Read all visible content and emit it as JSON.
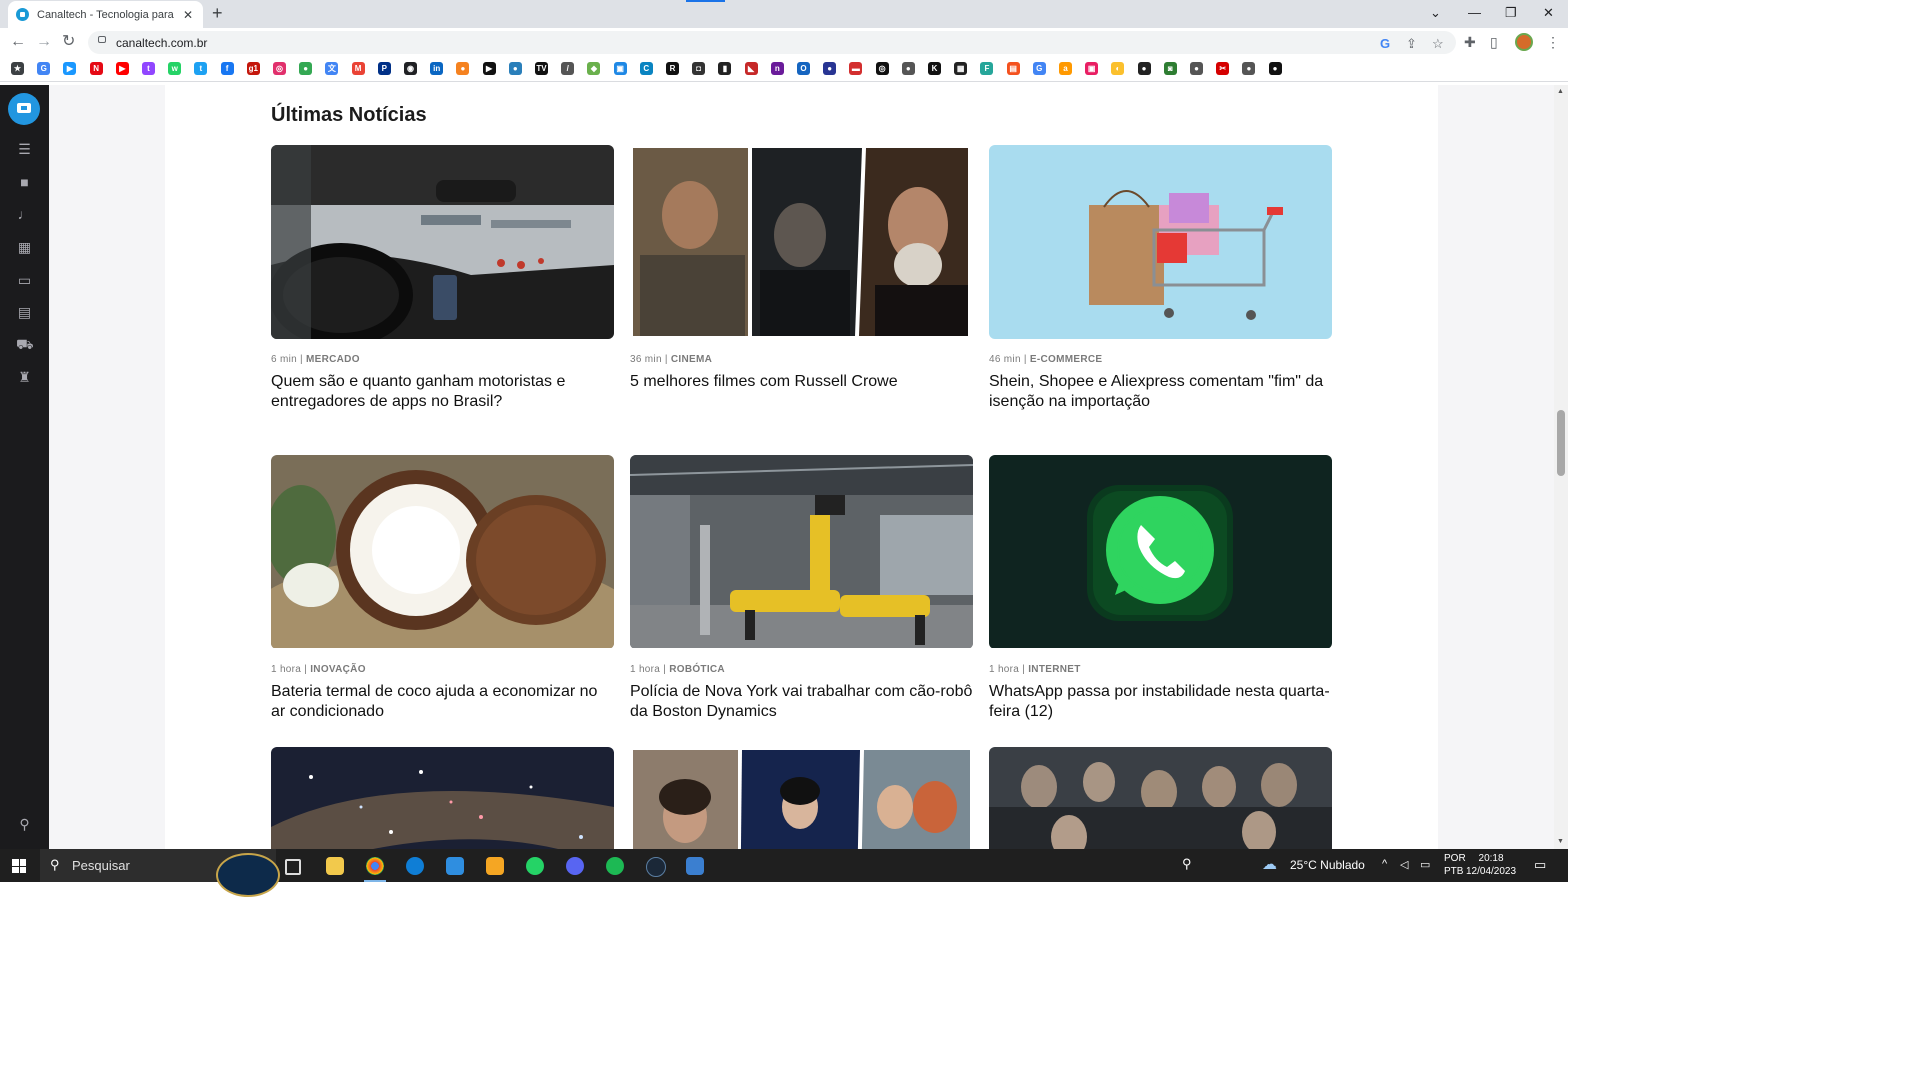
{
  "browser": {
    "tab_title": "Canaltech - Tecnologia para quem",
    "tab_close": "✕",
    "new_tab": "+",
    "url": "canaltech.com.br",
    "window_controls": [
      "⌄",
      "—",
      "❐",
      "✕"
    ]
  },
  "bookmarks": [
    {
      "icon": "star-icon",
      "color": "#3c4043",
      "glyph": "★"
    },
    {
      "icon": "google-icon",
      "color": "#4285f4",
      "glyph": "G"
    },
    {
      "icon": "prime-video-icon",
      "color": "#1a98ff",
      "glyph": "▶"
    },
    {
      "icon": "netflix-icon",
      "color": "#e50914",
      "glyph": "N"
    },
    {
      "icon": "youtube-icon",
      "color": "#ff0000",
      "glyph": "▶"
    },
    {
      "icon": "twitch-icon",
      "color": "#9146ff",
      "glyph": "t"
    },
    {
      "icon": "whatsapp-icon",
      "color": "#25d366",
      "glyph": "w"
    },
    {
      "icon": "twitter-icon",
      "color": "#1da1f2",
      "glyph": "t"
    },
    {
      "icon": "facebook-icon",
      "color": "#1877f2",
      "glyph": "f"
    },
    {
      "icon": "g1-icon",
      "color": "#c4170c",
      "glyph": "g1"
    },
    {
      "icon": "instagram-icon",
      "color": "#e1306c",
      "glyph": "◎"
    },
    {
      "icon": "maps-icon",
      "color": "#34a853",
      "glyph": "●"
    },
    {
      "icon": "translate-icon",
      "color": "#4285f4",
      "glyph": "文"
    },
    {
      "icon": "gmail-icon",
      "color": "#ea4335",
      "glyph": "M"
    },
    {
      "icon": "playstation-icon",
      "color": "#003087",
      "glyph": "P"
    },
    {
      "icon": "bookmark-icon",
      "color": "#202124",
      "glyph": "◉"
    },
    {
      "icon": "linkedin-icon",
      "color": "#0a66c2",
      "glyph": "in"
    },
    {
      "icon": "bookmark-icon",
      "color": "#f58220",
      "glyph": "●"
    },
    {
      "icon": "bookmark-icon",
      "color": "#111111",
      "glyph": "▶"
    },
    {
      "icon": "bookmark-icon",
      "color": "#2a7fba",
      "glyph": "●"
    },
    {
      "icon": "bookmark-icon",
      "color": "#111111",
      "glyph": "TV"
    },
    {
      "icon": "bookmark-icon",
      "color": "#555555",
      "glyph": "/"
    },
    {
      "icon": "bookmark-icon",
      "color": "#6ab04c",
      "glyph": "◆"
    },
    {
      "icon": "bookmark-icon",
      "color": "#1e88e5",
      "glyph": "▣"
    },
    {
      "icon": "bookmark-icon",
      "color": "#0a84c1",
      "glyph": "C"
    },
    {
      "icon": "bookmark-icon",
      "color": "#111111",
      "glyph": "R"
    },
    {
      "icon": "bookmark-icon",
      "color": "#333333",
      "glyph": "◘"
    },
    {
      "icon": "bookmark-icon",
      "color": "#222222",
      "glyph": "▮"
    },
    {
      "icon": "bookmark-icon",
      "color": "#c62828",
      "glyph": "◣"
    },
    {
      "icon": "bookmark-icon",
      "color": "#6a1b9a",
      "glyph": "n"
    },
    {
      "icon": "bookmark-icon",
      "color": "#1565c0",
      "glyph": "O"
    },
    {
      "icon": "bookmark-icon",
      "color": "#283593",
      "glyph": "●"
    },
    {
      "icon": "bookmark-icon",
      "color": "#d32f2f",
      "glyph": "▬"
    },
    {
      "icon": "bookmark-icon",
      "color": "#111111",
      "glyph": "◎"
    },
    {
      "icon": "bookmark-icon",
      "color": "#555555",
      "glyph": "●"
    },
    {
      "icon": "bookmark-icon",
      "color": "#111111",
      "glyph": "K"
    },
    {
      "icon": "bookmark-icon",
      "color": "#222222",
      "glyph": "▦"
    },
    {
      "icon": "bookmark-icon",
      "color": "#26a69a",
      "glyph": "F"
    },
    {
      "icon": "bookmark-icon",
      "color": "#f4511e",
      "glyph": "▤"
    },
    {
      "icon": "google-icon",
      "color": "#4285f4",
      "glyph": "G"
    },
    {
      "icon": "amazon-icon",
      "color": "#ff9900",
      "glyph": "a"
    },
    {
      "icon": "bookmark-icon",
      "color": "#e91e63",
      "glyph": "▣"
    },
    {
      "icon": "bookmark-icon",
      "color": "#fbc02d",
      "glyph": "◐"
    },
    {
      "icon": "bookmark-icon",
      "color": "#222222",
      "glyph": "●"
    },
    {
      "icon": "bookmark-icon",
      "color": "#2e7d32",
      "glyph": "◙"
    },
    {
      "icon": "bookmark-icon",
      "color": "#555555",
      "glyph": "●"
    },
    {
      "icon": "bookmark-icon",
      "color": "#d50000",
      "glyph": "✂"
    },
    {
      "icon": "bookmark-icon",
      "color": "#555555",
      "glyph": "●"
    },
    {
      "icon": "bookmark-icon",
      "color": "#111111",
      "glyph": "●"
    }
  ],
  "sidebar": {
    "items": [
      "menu-icon",
      "video-icon",
      "microphone-icon",
      "building-icon",
      "devices-icon",
      "store-icon",
      "cart-icon",
      "trophy-icon",
      "search-icon"
    ]
  },
  "page": {
    "section_title": "Últimas Notícias",
    "articles": [
      {
        "time": "6 min",
        "category": "MERCADO",
        "headline": "Quem são e quanto ganham motoristas e entregadores de apps no Brasil?",
        "image": "car-dashboard-image"
      },
      {
        "time": "36 min",
        "category": "CINEMA",
        "headline": "5 melhores filmes com Russell Crowe",
        "image": "russell-crowe-collage-image"
      },
      {
        "time": "46 min",
        "category": "E-COMMERCE",
        "headline": "Shein, Shopee e Aliexpress comentam \"fim\" da isenção na importação",
        "image": "shopping-cart-image"
      },
      {
        "time": "1 hora",
        "category": "INOVAÇÃO",
        "headline": "Bateria termal de coco ajuda a economizar no ar condicionado",
        "image": "coconut-image"
      },
      {
        "time": "1 hora",
        "category": "ROBÓTICA",
        "headline": "Polícia de Nova York vai trabalhar com cão-robô da Boston Dynamics",
        "image": "robot-dog-image"
      },
      {
        "time": "1 hora",
        "category": "INTERNET",
        "headline": "WhatsApp passa por instabilidade nesta quarta-feira (12)",
        "image": "whatsapp-logo-image"
      },
      {
        "image": "galaxy-image"
      },
      {
        "image": "movie-collage-image"
      },
      {
        "image": "game-of-thrones-image"
      }
    ]
  },
  "taskbar": {
    "search_placeholder": "Pesquisar",
    "weather": "25°C  Nublado",
    "lang_1": "POR",
    "lang_2": "PTB",
    "time": "20:18",
    "date": "12/04/2023"
  },
  "colors": {
    "accent": "#2296e0",
    "sidebar_bg": "#1b1b1d",
    "taskbar_bg": "#1f1f1f"
  }
}
